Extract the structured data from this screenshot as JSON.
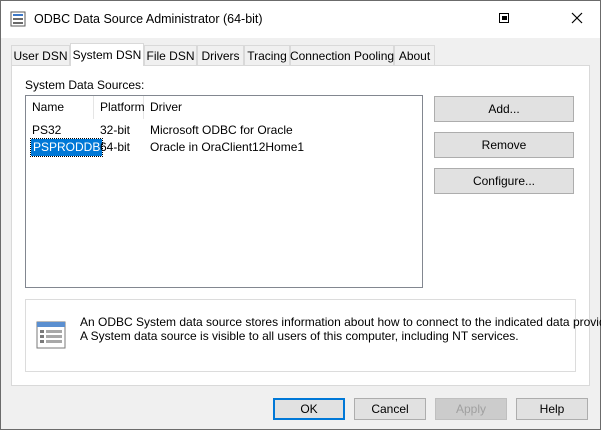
{
  "window": {
    "title": "ODBC Data Source Administrator (64-bit)",
    "icons": {
      "app": "odbc-app-icon",
      "help": "context-help-icon",
      "close": "close-icon"
    }
  },
  "tabs": [
    {
      "label": "User DSN",
      "active": false
    },
    {
      "label": "System DSN",
      "active": true
    },
    {
      "label": "File DSN",
      "active": false
    },
    {
      "label": "Drivers",
      "active": false
    },
    {
      "label": "Tracing",
      "active": false
    },
    {
      "label": "Connection Pooling",
      "active": false
    },
    {
      "label": "About",
      "active": false
    }
  ],
  "system_dsn": {
    "group_label": "System Data Sources:",
    "columns": [
      "Name",
      "Platform",
      "Driver"
    ],
    "rows": [
      {
        "name": "PS32",
        "platform": "32-bit",
        "driver": "Microsoft ODBC for Oracle",
        "selected": false
      },
      {
        "name": "PSPRODDB",
        "platform": "64-bit",
        "driver": "Oracle in OraClient12Home1",
        "selected": true
      }
    ],
    "buttons": {
      "add": "Add...",
      "remove": "Remove",
      "configure": "Configure..."
    },
    "info": {
      "icon": "data-source-icon",
      "line1": "An ODBC System data source stores information about how to connect to the indicated data provider.",
      "line2": "A System data source is visible to all users of this computer, including NT services."
    }
  },
  "footer": {
    "ok": "OK",
    "cancel": "Cancel",
    "apply": "Apply",
    "help": "Help"
  },
  "colors": {
    "selection": "#0078d7",
    "default_button_border": "#0078d7",
    "disabled_text": "#a0a0a0"
  }
}
